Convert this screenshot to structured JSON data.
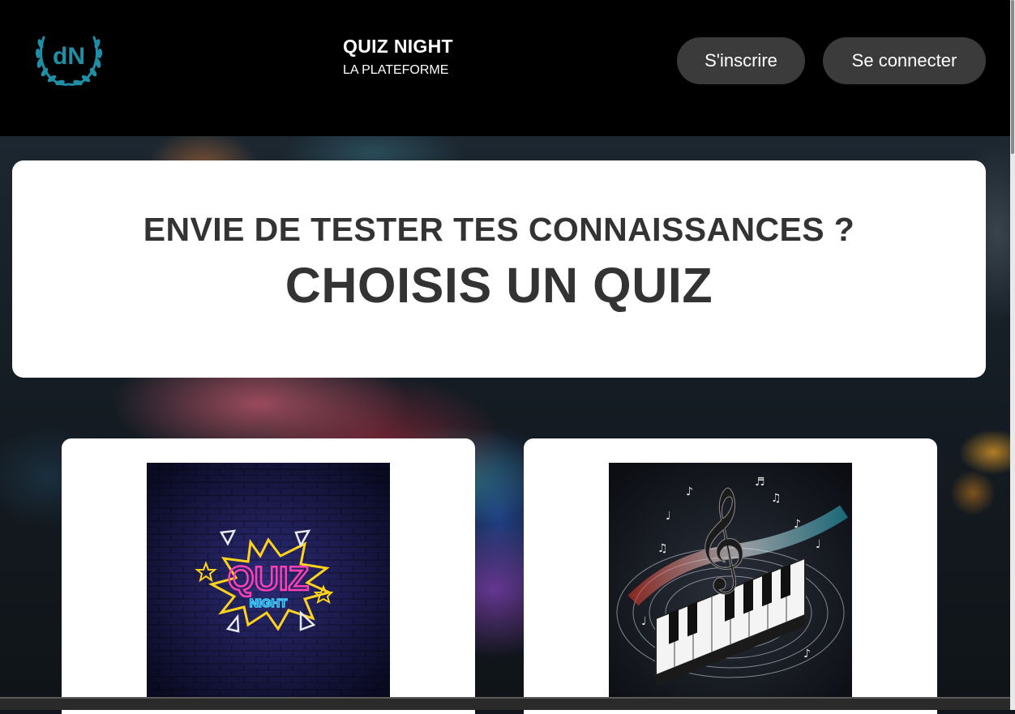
{
  "header": {
    "title": "QUIZ NIGHT",
    "subtitle": "LA PLATEFORME",
    "register_label": "S'inscrire",
    "login_label": "Se connecter",
    "logo_text": "dN"
  },
  "hero": {
    "question": "ENVIE DE TESTER TES CONNAISSANCES ?",
    "cta": "CHOISIS UN QUIZ"
  },
  "cards": [
    {
      "image": "quiz-night-neon-image",
      "neon_word": "QUIZ",
      "neon_sub": "NIGHT"
    },
    {
      "image": "music-piano-image"
    }
  ],
  "colors": {
    "header_bg": "#000000",
    "button_bg": "#3b3b3b",
    "logo": "#1e8fa6",
    "hero_text": "#333333",
    "neon_pink": "#ff3fb4",
    "neon_yellow": "#ffd21e",
    "neon_blue": "#3fd0ff"
  }
}
